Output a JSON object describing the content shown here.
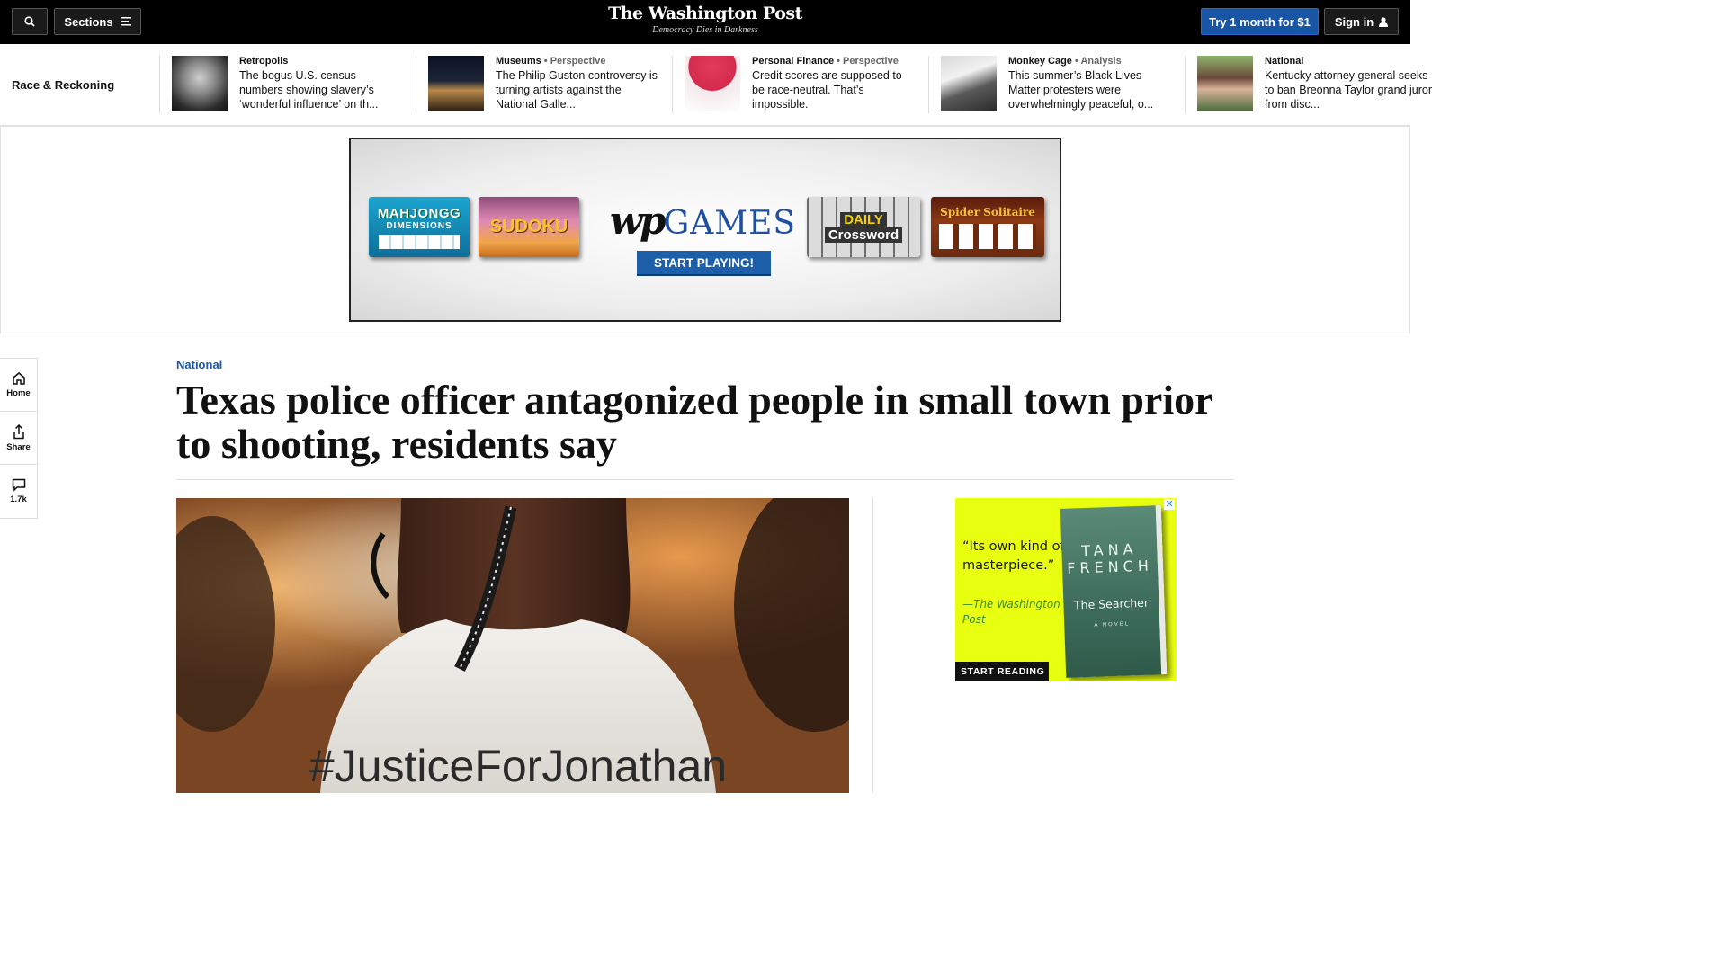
{
  "header": {
    "sections_label": "Sections",
    "logo_name": "The Washington Post",
    "logo_tagline": "Democracy Dies in Darkness",
    "subscribe_label": "Try 1 month for $1",
    "signin_label": "Sign in"
  },
  "strip": {
    "title": "Race & Reckoning",
    "items": [
      {
        "kicker": "Retropolis",
        "tag": "",
        "headline": "The bogus U.S. census numbers showing slavery’s ‘wonderful influence’ on th..."
      },
      {
        "kicker": "Museums",
        "tag": " • Perspective",
        "headline": "The Philip Guston controversy is turning artists against the National Galle..."
      },
      {
        "kicker": "Personal Finance",
        "tag": " • Perspective",
        "headline": "Credit scores are supposed to be race-neutral. That’s impossible."
      },
      {
        "kicker": "Monkey Cage",
        "tag": " • Analysis",
        "headline": "This summer’s Black Lives Matter protesters were overwhelmingly peaceful, o..."
      },
      {
        "kicker": "National",
        "tag": "",
        "headline": "Kentucky attorney general seeks to ban Breonna Taylor grand juror from disc..."
      }
    ]
  },
  "games_ad": {
    "tiles": [
      "MAHJONGG",
      "DIMENSIONS",
      "SUDOKU",
      "DAILY",
      "Crossword",
      "Spider Solitaire"
    ],
    "brand_wp": "wp",
    "brand_games": "GAMES",
    "cta": "START PLAYING!"
  },
  "rail": {
    "home": "Home",
    "share": "Share",
    "comments": "1.7k"
  },
  "article": {
    "section": "National",
    "headline": "Texas police officer antagonized people in small town prior to shooting, residents say",
    "photo_shirt_text": "#JusticeForJonathan"
  },
  "book_ad": {
    "quote": "“Its own kind of masterpiece.”",
    "attribution": "—The Washington Post",
    "author": "TANA FRENCH",
    "title": "The Searcher",
    "subtitle": "A NOVEL",
    "cta": "START READING",
    "close": "✕"
  }
}
